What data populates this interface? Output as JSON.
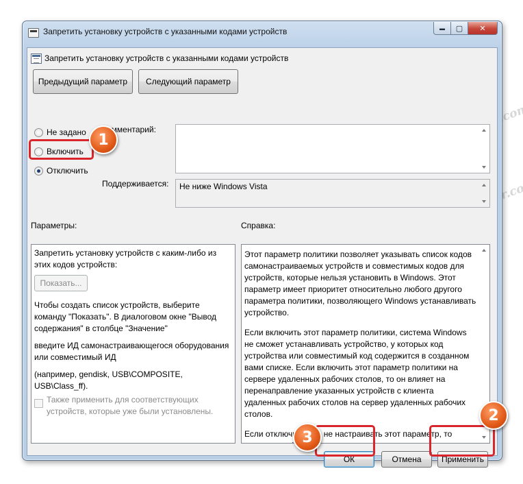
{
  "window": {
    "title": "Запретить установку устройств с указанными кодами устройств",
    "minimize_glyph": "▬",
    "maximize_glyph": "▢",
    "close_glyph": "✕"
  },
  "policy": {
    "title": "Запретить установку устройств с указанными кодами устройств"
  },
  "nav": {
    "prev_label": "Предыдущий параметр",
    "next_label": "Следующий параметр"
  },
  "state": {
    "not_configured": "Не задано",
    "enabled": "Включить",
    "disabled": "Отключить",
    "selected": "disabled"
  },
  "comment": {
    "label": "Комментарий:",
    "value": ""
  },
  "supported": {
    "label": "Поддерживается:",
    "value": "Не ниже Windows Vista"
  },
  "params": {
    "label": "Параметры:",
    "line1": "Запретить установку устройств с каким-либо из этих кодов устройств:",
    "show_button": "Показать...",
    "line2": "Чтобы создать список устройств, выберите команду \"Показать\". В диалоговом окне \"Вывод содержания\" в столбце \"Значение\"",
    "line3": "введите ИД самонастраивающегося оборудования или совместимый ИД",
    "line4": "(например, gendisk, USB\\COMPOSITE, USB\\Class_ff).",
    "checkbox_label": "Также применить для соответствующих устройств, которые уже были установлены."
  },
  "help": {
    "label": "Справка:",
    "p1": "Этот параметр политики позволяет указывать список кодов самонастраиваемых устройств и совместимых кодов для устройств, которые нельзя установить в Windows. Этот параметр имеет приоритет относительно любого другого параметра политики, позволяющего Windows устанавливать устройство.",
    "p2": "Если включить этот параметр политики, система Windows не сможет устанавливать устройство, у которых код устройства или совместимый код содержится в созданном вами списке. Если включить этот параметр политики на сервере удаленных рабочих столов, то он влияет на перенаправление указанных устройств с клиента удаленных рабочих столов на сервер удаленных рабочих столов.",
    "p3": "Если отключить или не настраивать этот параметр, то новые устройства можно устанавливать, а существующие обновлять, насколько это разрешено или запрещено другими параметрами политики."
  },
  "buttons": {
    "ok": "ОК",
    "cancel": "Отмена",
    "apply": "Применить"
  },
  "badges": {
    "b1": "1",
    "b2": "2",
    "b3": "3"
  },
  "watermark": "Soringpcrepair.com",
  "colors": {
    "badge": "#e25a18",
    "highlight": "#d8262c"
  }
}
